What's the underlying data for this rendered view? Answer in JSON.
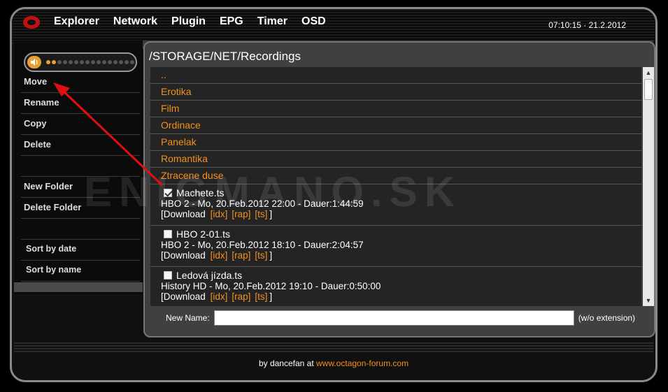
{
  "header": {
    "nav": [
      "Explorer",
      "Network",
      "Plugin",
      "EPG",
      "Timer",
      "OSD"
    ],
    "clock": "07:10:15 · 21.2.2012"
  },
  "volume": {
    "level_dots_on": 2,
    "total_dots": 16
  },
  "sidebar": {
    "items": [
      "Move",
      "Rename",
      "Copy",
      "Delete",
      "",
      "New Folder",
      "Delete Folder",
      "",
      "Sort by date",
      "Sort by name"
    ]
  },
  "content": {
    "path": "/STORAGE/NET/Recordings",
    "folders": [
      "..",
      "Erotika",
      "Film",
      "Ordinace",
      "Panelak",
      "Romantika",
      "Ztracene duse"
    ],
    "recordings": [
      {
        "name": "Machete.ts",
        "checked": true,
        "info": "HBO 2   -   Mo, 20.Feb.2012 22:00  -  Dauer:1:44:59"
      },
      {
        "name": "HBO 2-01.ts",
        "checked": false,
        "info": "HBO 2   -   Mo, 20.Feb.2012 18:10  -  Dauer:2:04:57"
      },
      {
        "name": "Ledová jízda.ts",
        "checked": false,
        "info": "History HD   -   Mo, 20.Feb.2012 19:10  -  Dauer:0:50:00"
      }
    ],
    "download_label": "[Download",
    "download_close": "]",
    "download_links": [
      "[idx]",
      "[rap]",
      "[ts]"
    ],
    "new_name_label": "New Name:",
    "new_name_value": "",
    "ext_note": "(w/o extension)"
  },
  "footer": {
    "by": "by dancefan at",
    "link": "www.octagon-forum.com"
  },
  "watermark": "ENIGMANO.SK",
  "colors": {
    "accent": "#f29020",
    "annotation_arrow": "#e01010"
  },
  "icons": {
    "logo": "octagon-logo-icon",
    "speaker": "speaker-icon",
    "scroll_up": "arrow-up-icon",
    "scroll_down": "arrow-down-icon"
  }
}
